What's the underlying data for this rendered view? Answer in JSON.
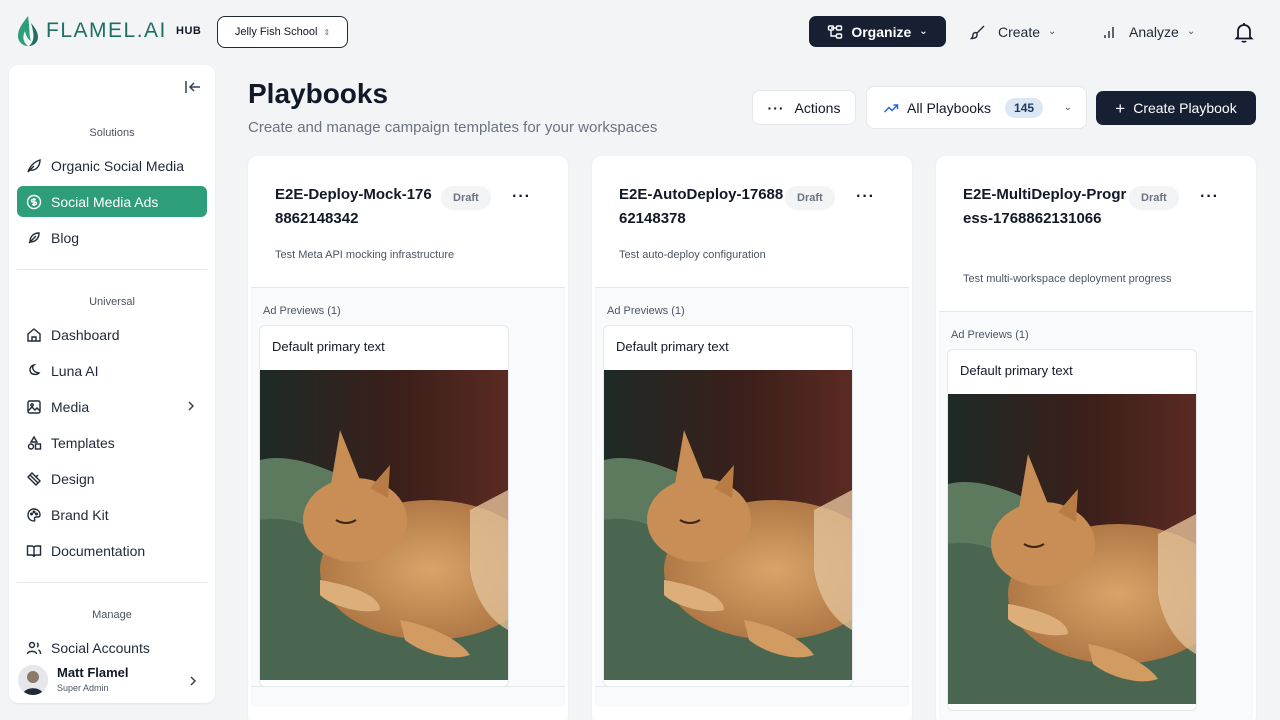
{
  "header": {
    "logo_text": "FLAMEL.AI",
    "hub_label": "HUB",
    "school": "Jelly Fish School",
    "nav": {
      "organize": "Organize",
      "create": "Create",
      "analyze": "Analyze"
    }
  },
  "sidebar": {
    "sections": {
      "solutions": "Solutions",
      "universal": "Universal",
      "manage": "Manage"
    },
    "solutions": [
      "Organic Social Media",
      "Social Media Ads",
      "Blog"
    ],
    "universal": [
      "Dashboard",
      "Luna AI",
      "Media",
      "Templates",
      "Design",
      "Brand Kit",
      "Documentation"
    ],
    "manage": [
      "Social Accounts"
    ],
    "user": {
      "name": "Matt Flamel",
      "role": "Super Admin"
    }
  },
  "main": {
    "title": "Playbooks",
    "subtitle": "Create and manage campaign templates for your workspaces",
    "actions_label": "Actions",
    "filter_label": "All Playbooks",
    "filter_count": "145",
    "create_label": "Create Playbook"
  },
  "cards": [
    {
      "title": "E2E-Deploy-Mock-1768862148342",
      "status": "Draft",
      "description": "Test Meta API mocking infrastructure",
      "preview_label": "Ad Previews (1)",
      "ad_text": "Default primary text"
    },
    {
      "title": "E2E-AutoDeploy-1768862148378",
      "status": "Draft",
      "description": "Test auto-deploy configuration",
      "preview_label": "Ad Previews (1)",
      "ad_text": "Default primary text"
    },
    {
      "title": "E2E-MultiDeploy-Progress-1768862131066",
      "status": "Draft",
      "description": "Test multi-workspace deployment progress",
      "preview_label": "Ad Previews (1)",
      "ad_text": "Default primary text"
    }
  ],
  "colors": {
    "brand": "#1f6f63",
    "active_nav": "#2e9e7a",
    "dark_button": "#172033"
  }
}
